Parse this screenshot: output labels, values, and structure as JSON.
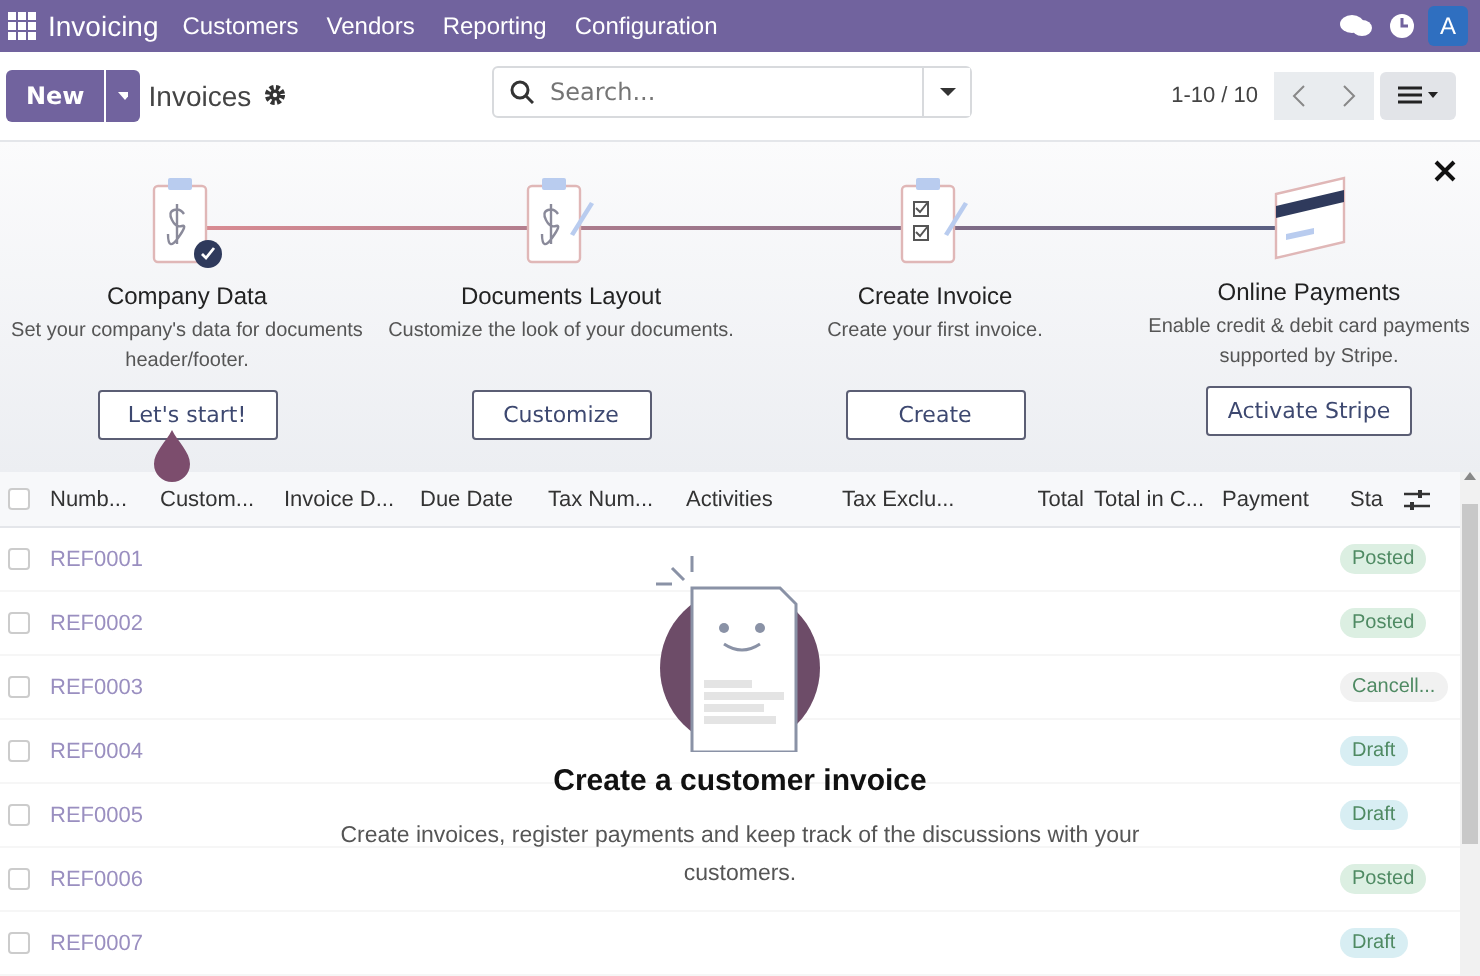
{
  "app": {
    "name": "Invoicing",
    "menu": [
      "Customers",
      "Vendors",
      "Reporting",
      "Configuration"
    ],
    "avatar": "A"
  },
  "control": {
    "new_button": "New",
    "breadcrumb": "Invoices",
    "search": {
      "placeholder": "Search..."
    },
    "pager": "1-10 / 10"
  },
  "onboarding": {
    "steps": [
      {
        "kind": "company",
        "title": "Company Data",
        "description": "Set your company's data for documents header/footer.",
        "button": "Let's start!",
        "done": true
      },
      {
        "kind": "layout",
        "title": "Documents Layout",
        "description": "Customize the look of your documents.",
        "button": "Customize",
        "done": false
      },
      {
        "kind": "invoice",
        "title": "Create Invoice",
        "description": "Create your first invoice.",
        "button": "Create",
        "done": false
      },
      {
        "kind": "payment",
        "title": "Online Payments",
        "description": "Enable credit & debit card payments supported by Stripe.",
        "button": "Activate Stripe",
        "done": false
      }
    ]
  },
  "table": {
    "select_all_checked": false,
    "columns": [
      "Numb...",
      "Custom...",
      "Invoice D...",
      "Due Date",
      "Tax Num...",
      "Activities",
      "Tax Exclu...",
      "Total",
      "Total in C...",
      "Payment",
      "Sta"
    ],
    "rows": [
      {
        "number": "REF0001",
        "status": "Posted",
        "color": "#dcefe2",
        "checked": false
      },
      {
        "number": "REF0002",
        "status": "Posted",
        "color": "#dcefe2",
        "checked": false
      },
      {
        "number": "REF0003",
        "status": "Cancell...",
        "color": "#f1f1f1",
        "checked": false
      },
      {
        "number": "REF0004",
        "status": "Draft",
        "color": "#d8eef3",
        "checked": false
      },
      {
        "number": "REF0005",
        "status": "Draft",
        "color": "#d8eef3",
        "checked": false
      },
      {
        "number": "REF0006",
        "status": "Posted",
        "color": "#dcefe2",
        "checked": false
      },
      {
        "number": "REF0007",
        "status": "Draft",
        "color": "#d8eef3",
        "checked": false
      }
    ]
  },
  "empty_state": {
    "title": "Create a customer invoice",
    "text": "Create invoices, register payments and keep track of the discussions with your customers."
  }
}
